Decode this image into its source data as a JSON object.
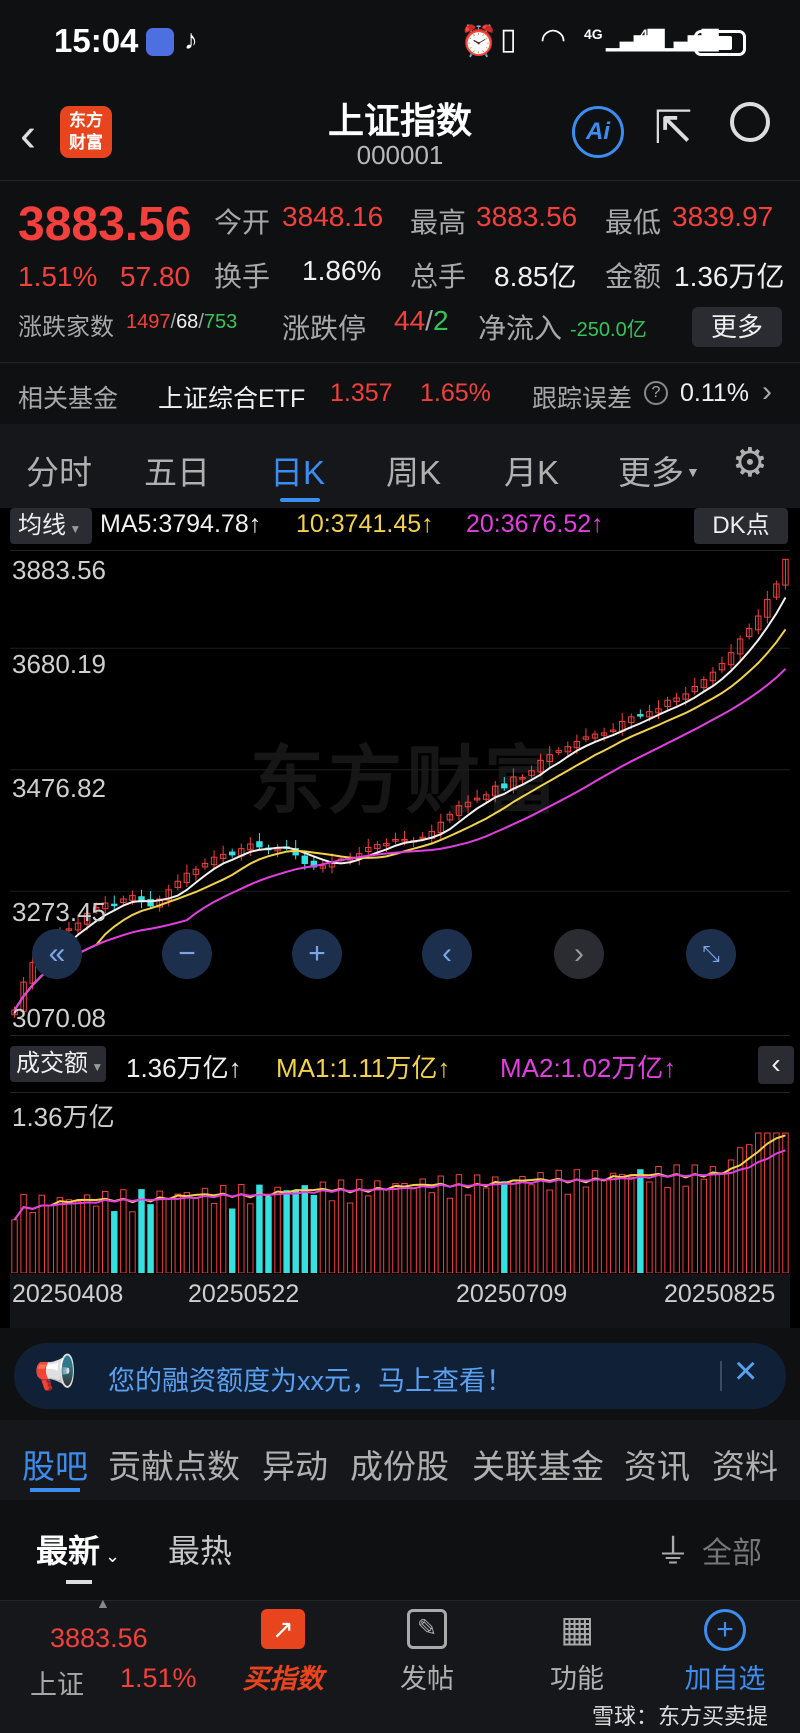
{
  "statusbar": {
    "time": "15:04",
    "network1": "4G",
    "network2": "4G"
  },
  "header": {
    "logo_line1": "东方",
    "logo_line2": "财富",
    "title": "上证指数",
    "code": "000001",
    "ai_label": "Ai"
  },
  "quote": {
    "price": "3883.56",
    "change_pct": "1.51%",
    "change": "57.80",
    "open_label": "今开",
    "open": "3848.16",
    "high_label": "最高",
    "high": "3883.56",
    "low_label": "最低",
    "low": "3839.97",
    "turnover_label": "换手",
    "turnover": "1.86%",
    "volume_label": "总手",
    "volume": "8.85亿",
    "amount_label": "金额",
    "amount": "1.36万亿",
    "breadth_label": "涨跌家数",
    "breadth_up": "1497",
    "breadth_flat": "68",
    "breadth_down": "753",
    "limit_label": "涨跌停",
    "limit_up": "44",
    "limit_down": "2",
    "inflow_label": "净流入",
    "inflow": "-250.0亿",
    "more_label": "更多"
  },
  "fund": {
    "label": "相关基金",
    "name": "上证综合ETF",
    "price": "1.357",
    "pct": "1.65%",
    "error_label": "跟踪误差",
    "error_value": "0.11%"
  },
  "period_tabs": [
    "分时",
    "五日",
    "日K",
    "周K",
    "月K",
    "更多"
  ],
  "active_period": "日K",
  "ma_row": {
    "label": "均线",
    "ma5": "MA5:3794.78↑",
    "ma10": "10:3741.45↑",
    "ma20": "20:3676.52↑",
    "dk": "DK点"
  },
  "price_axis": [
    "3883.56",
    "3680.19",
    "3476.82",
    "3273.45",
    "3070.08"
  ],
  "vol_row": {
    "label": "成交额",
    "value": "1.36万亿↑",
    "ma1": "MA1:1.11万亿↑",
    "ma2": "MA2:1.02万亿↑"
  },
  "vol_axis_top": "1.36万亿",
  "dates": [
    "20250408",
    "20250522",
    "20250709",
    "20250825"
  ],
  "watermark": "东方财富",
  "colors": {
    "up": "#f2403c",
    "down": "#35e0e0",
    "ma5": "#f0f0f0",
    "ma10": "#f2d24a",
    "ma20": "#e23fe0",
    "accent": "#3b8ef0"
  },
  "chart_data": {
    "type": "candlestick",
    "ylim": [
      3070.08,
      3883.56
    ],
    "closes": [
      3096,
      3145,
      3179,
      3205,
      3215,
      3232,
      3238,
      3248,
      3265,
      3275,
      3283,
      3280,
      3290,
      3296,
      3285,
      3278,
      3290,
      3306,
      3321,
      3335,
      3342,
      3352,
      3363,
      3368,
      3367,
      3378,
      3386,
      3381,
      3376,
      3377,
      3380,
      3367,
      3352,
      3346,
      3348,
      3355,
      3360,
      3362,
      3369,
      3380,
      3385,
      3387,
      3394,
      3394,
      3392,
      3398,
      3408,
      3424,
      3438,
      3453,
      3459,
      3466,
      3472,
      3487,
      3484,
      3503,
      3502,
      3514,
      3532,
      3542,
      3549,
      3556,
      3565,
      3573,
      3578,
      3580,
      3585,
      3600,
      3608,
      3610,
      3617,
      3622,
      3637,
      3641,
      3648,
      3661,
      3673,
      3686,
      3701,
      3720,
      3744,
      3762,
      3784,
      3813,
      3840,
      3883
    ]
  },
  "banner": {
    "text": "您的融资额度为xx元，马上查看！"
  },
  "info_tabs": [
    "股吧",
    "贡献点数",
    "异动",
    "成份股",
    "关联基金",
    "资讯",
    "资料"
  ],
  "sub_tabs": {
    "latest": "最新",
    "hot": "最热",
    "filter": "全部"
  },
  "bottom_nav": {
    "index_price": "3883.56",
    "index_name": "上证",
    "index_pct": "1.51%",
    "buy": "买指数",
    "post": "发帖",
    "func": "功能",
    "add": "加自选",
    "watermark": "雪球：东方买卖提"
  }
}
